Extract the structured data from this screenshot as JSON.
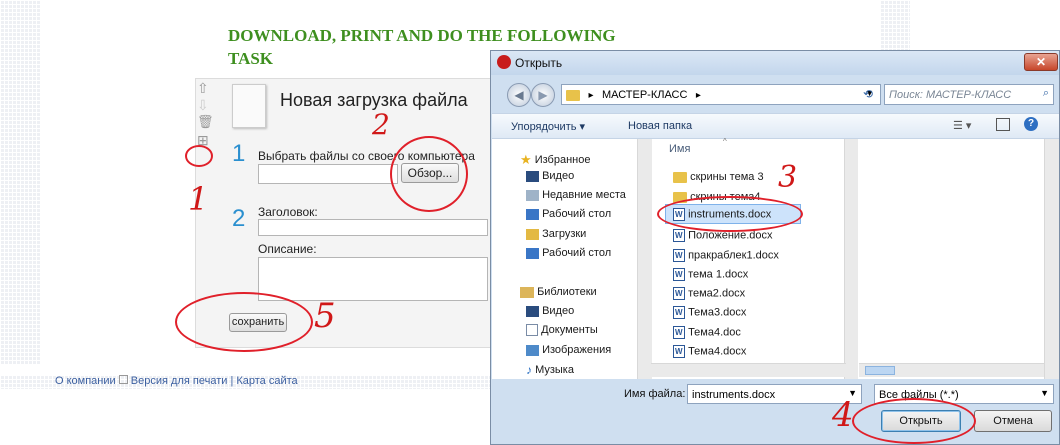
{
  "page": {
    "heading": "DOWNLOAD, PRINT AND DO THE FOLLOWING TASK",
    "footer": {
      "about": "О компании",
      "print_version": "Версия для печати",
      "separator": "|",
      "sitemap": "Карта сайта"
    }
  },
  "upload": {
    "title": "Новая загрузка файла",
    "step1": "1",
    "step2": "2",
    "choose_label": "Выбрать файлы со своего компьютера",
    "browse_button": "Обзор...",
    "title_label": "Заголовок:",
    "description_label": "Описание:",
    "save_button": "сохранить"
  },
  "annotations": {
    "n1": "1",
    "n2": "2",
    "n3": "3",
    "n4": "4",
    "n5": "5"
  },
  "dialog": {
    "title": "Открыть",
    "path": "МАСТЕР-КЛАСС",
    "search_placeholder": "Поиск: МАСТЕР-КЛАСС",
    "organize": "Упорядочить",
    "new_folder": "Новая папка",
    "column_name": "Имя",
    "nav": [
      {
        "label": "Избранное",
        "icon": "star-icon"
      },
      {
        "label": "Видео",
        "icon": "video-icon"
      },
      {
        "label": "Недавние места",
        "icon": "recent-icon"
      },
      {
        "label": "Рабочий стол",
        "icon": "desktop-icon"
      },
      {
        "label": "Загрузки",
        "icon": "downloads-icon"
      },
      {
        "label": "Рабочий стол",
        "icon": "desktop-icon"
      },
      {
        "label": "Библиотеки",
        "icon": "library-icon"
      },
      {
        "label": "Видео",
        "icon": "video-icon"
      },
      {
        "label": "Документы",
        "icon": "documents-icon"
      },
      {
        "label": "Изображения",
        "icon": "images-icon"
      },
      {
        "label": "Музыка",
        "icon": "music-icon"
      }
    ],
    "files": [
      {
        "name": "скрины тема 3",
        "type": "folder"
      },
      {
        "name": "скрины тема4",
        "type": "folder"
      },
      {
        "name": "instruments.docx",
        "type": "doc"
      },
      {
        "name": "Положение.docx",
        "type": "doc"
      },
      {
        "name": "пракраблек1.docx",
        "type": "doc"
      },
      {
        "name": "тема 1.docx",
        "type": "doc"
      },
      {
        "name": "тема2.docx",
        "type": "doc"
      },
      {
        "name": "Тема3.docx",
        "type": "doc"
      },
      {
        "name": "Тема4.doc",
        "type": "doc"
      },
      {
        "name": "Тема4.docx",
        "type": "doc"
      }
    ],
    "filename_label": "Имя файла:",
    "filename_value": "instruments.docx",
    "filter": "Все файлы (*.*)",
    "open_button": "Открыть",
    "cancel_button": "Отмена"
  }
}
